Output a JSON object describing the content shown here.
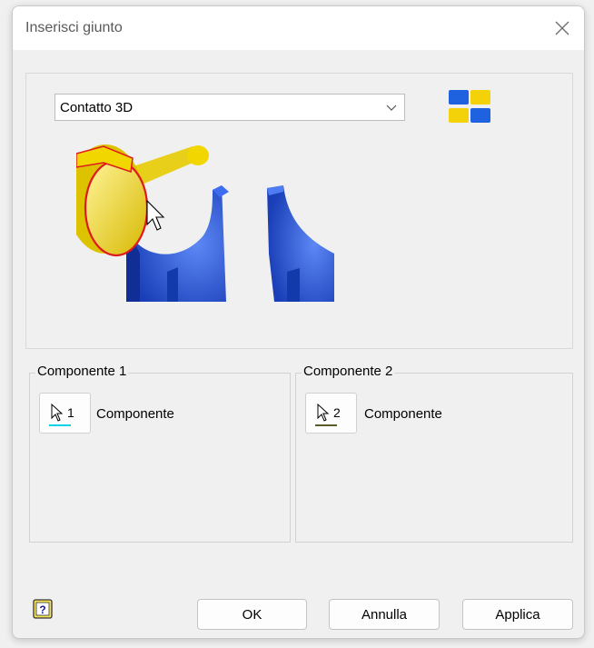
{
  "dialog": {
    "title": "Inserisci giunto",
    "close_icon": "close-icon"
  },
  "joint_type": {
    "selected": "Contatto 3D",
    "dropdown_icon": "chevron-down-icon",
    "color_toggle_icon": "component-colors-icon"
  },
  "preview": {
    "icon": "joint-preview-illustration"
  },
  "component1": {
    "legend": "Componente 1",
    "select_number": "1",
    "select_label": "Componente",
    "indicator_color": "#00d3e6",
    "icon": "cursor-select-icon"
  },
  "component2": {
    "legend": "Componente 2",
    "select_number": "2",
    "select_label": "Componente",
    "indicator_color": "#5a5a2a",
    "icon": "cursor-select-icon"
  },
  "footer": {
    "help_icon": "help-icon",
    "ok_label": "OK",
    "cancel_label": "Annulla",
    "apply_label": "Applica"
  },
  "colors": {
    "part_yellow": "#f2d600",
    "part_blue": "#1f4fd1",
    "highlight_red": "#e0191d"
  }
}
